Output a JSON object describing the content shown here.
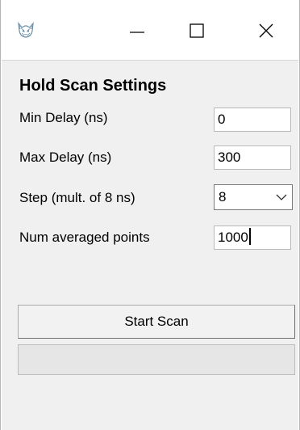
{
  "window": {
    "title_icon": "cat-face-icon",
    "controls": {
      "minimize": "minimize-icon",
      "maximize": "maximize-icon",
      "close": "close-icon"
    }
  },
  "panel": {
    "heading": "Hold Scan Settings",
    "min_delay": {
      "label": "Min Delay (ns)",
      "value": "0"
    },
    "max_delay": {
      "label": "Max Delay (ns)",
      "value": "300"
    },
    "step": {
      "label": "Step (mult. of 8 ns)",
      "value": "8"
    },
    "num_points": {
      "label": "Num averaged points",
      "value": "1000"
    },
    "start_button": "Start Scan",
    "progress": 0
  },
  "colors": {
    "window_bg": "#ffffff",
    "client_bg": "#f0f0f0",
    "field_border": "#b9b9b9"
  }
}
